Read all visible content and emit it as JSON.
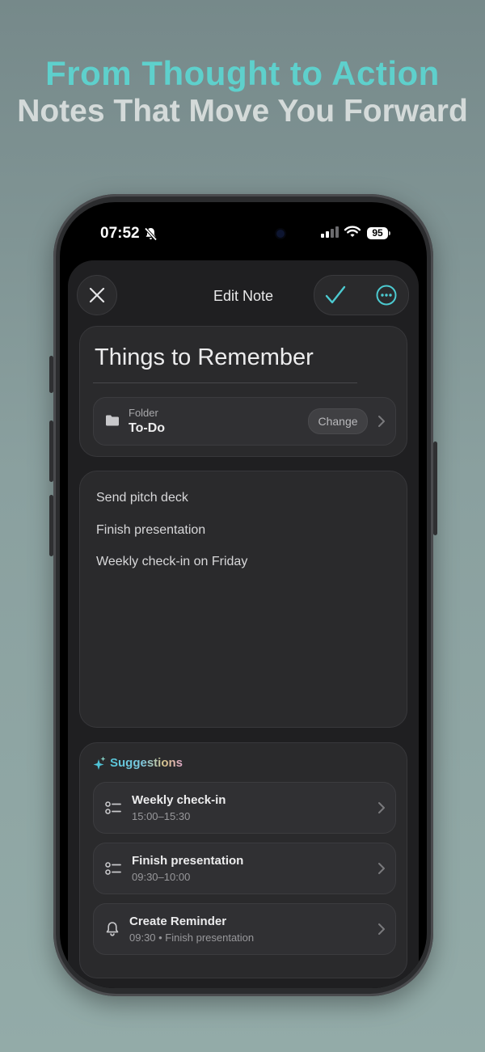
{
  "promo": {
    "headline": "From Thought to Action",
    "subheadline": "Notes That Move You Forward",
    "colors": {
      "headline": "#5ed0cc",
      "subheadline": "#e4e8e7"
    }
  },
  "status_bar": {
    "time": "07:52",
    "battery": "95",
    "icons": [
      "bell-slash-icon",
      "signal-icon",
      "wifi-icon",
      "battery-icon"
    ]
  },
  "nav": {
    "title": "Edit Note",
    "icons": [
      "close-icon",
      "checkmark-icon",
      "more-icon"
    ],
    "accent": "#4ccad0"
  },
  "note": {
    "title": "Things to Remember",
    "folder": {
      "label": "Folder",
      "value": "To-Do",
      "change_label": "Change"
    },
    "lines": [
      "Send pitch deck",
      "Finish presentation",
      "Weekly check-in on Friday"
    ]
  },
  "suggestions": {
    "title": "Suggestions",
    "items": [
      {
        "title": "Weekly check-in",
        "subtitle": "15:00–15:30",
        "icon": "checklist-icon"
      },
      {
        "title": "Finish presentation",
        "subtitle": "09:30–10:00",
        "icon": "checklist-icon"
      },
      {
        "title": "Create Reminder",
        "subtitle": "09:30 • Finish presentation",
        "icon": "bell-icon"
      }
    ]
  }
}
